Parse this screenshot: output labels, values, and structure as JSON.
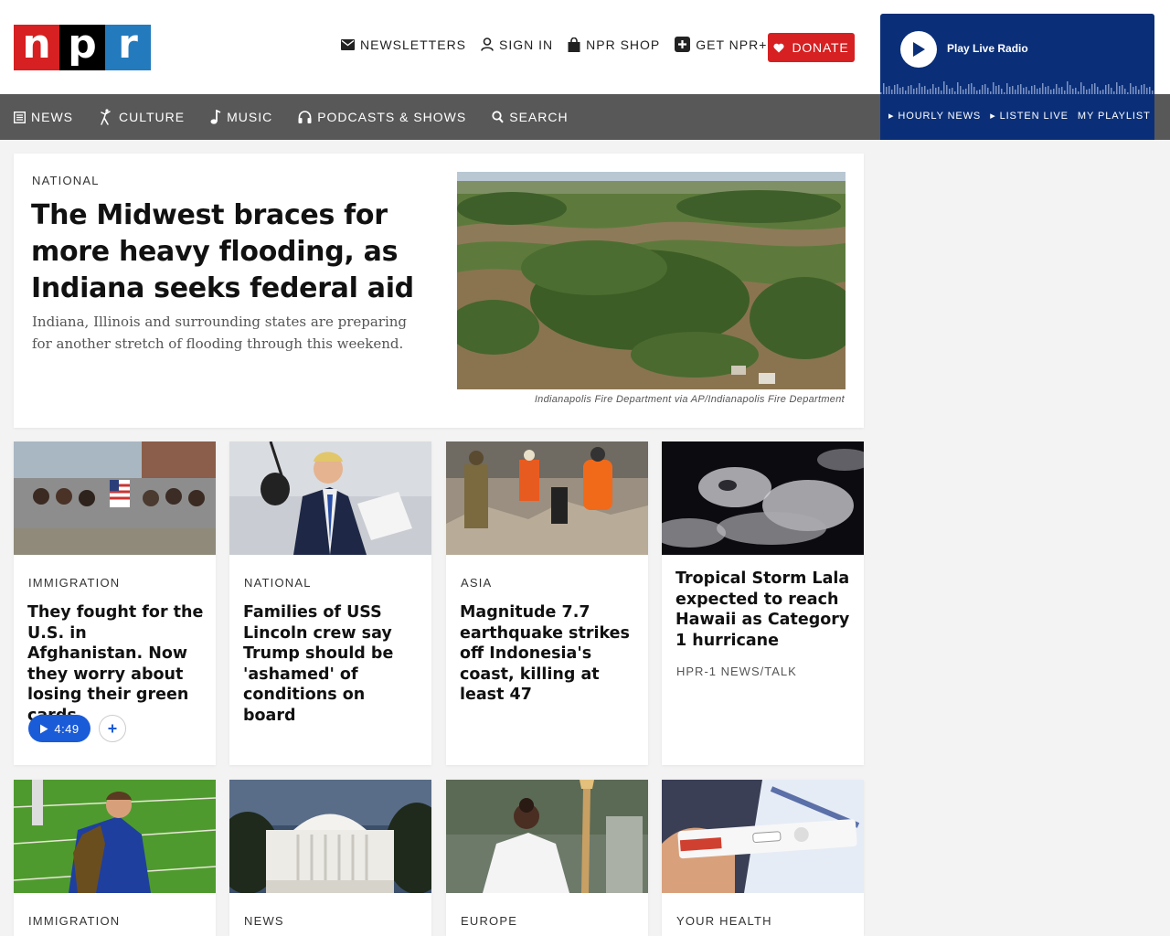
{
  "logo": {
    "letters": [
      "n",
      "p",
      "r"
    ]
  },
  "utility_nav": [
    {
      "label": "Newsletters",
      "icon": "envelope-icon"
    },
    {
      "label": "Sign In",
      "icon": "user-icon"
    },
    {
      "label": "NPR Shop",
      "icon": "shopping-bag-icon"
    },
    {
      "label": "Get NPR+",
      "icon": "plus-square-icon"
    }
  ],
  "donate": {
    "label": "DONATE",
    "icon": "heart-icon"
  },
  "player": {
    "play_label": "Play Live Radio",
    "links": [
      "Hourly News",
      "Listen Live",
      "My Playlist"
    ]
  },
  "main_nav": [
    {
      "label": "News",
      "icon": "newspaper-icon"
    },
    {
      "label": "Culture",
      "icon": "culture-icon"
    },
    {
      "label": "Music",
      "icon": "music-note-icon"
    },
    {
      "label": "Podcasts & Shows",
      "icon": "headphones-icon"
    },
    {
      "label": "Search",
      "icon": "search-icon"
    }
  ],
  "hero": {
    "slug": "National",
    "headline": "The Midwest braces for more heavy flooding, as Indiana seeks federal aid",
    "teaser": "Indiana, Illinois and surrounding states are preparing for another stretch of flooding through this weekend.",
    "image_alt": "Aerial view of flooded neighborhood surrounded by trees",
    "credit": "Indianapolis Fire Department via AP/Indianapolis Fire Department"
  },
  "cards": [
    {
      "slug": "Immigration",
      "title": "They fought for the U.S. in Afghanistan. Now they worry about losing their green cards",
      "audio_duration": "4:49",
      "image": "mural-wall"
    },
    {
      "slug": "National",
      "title": "Families of USS Lincoln crew say Trump should be 'ashamed' of conditions on board",
      "image": "speaker-microphone"
    },
    {
      "slug": "Asia",
      "title": "Magnitude 7.7 earthquake strikes off Indonesia's coast, killing at least 47",
      "image": "rescue-rubble"
    },
    {
      "title": "Tropical Storm Lala expected to reach Hawaii as Category 1 hurricane",
      "station": "HPR-1 News/Talk",
      "image": "satellite-storm"
    },
    {
      "slug": "Immigration",
      "image": "soccer-field-trophy"
    },
    {
      "slug": "News",
      "image": "white-house"
    },
    {
      "slug": "Europe",
      "image": "torch-bearer"
    },
    {
      "slug": "Your Health",
      "image": "covid-test"
    }
  ],
  "colors": {
    "npr_red": "#d62021",
    "npr_black": "#000000",
    "npr_blue": "#237bbd",
    "nav_gray": "#585858",
    "player_blue": "#0a2f78",
    "audio_blue": "#1a5bd8"
  }
}
